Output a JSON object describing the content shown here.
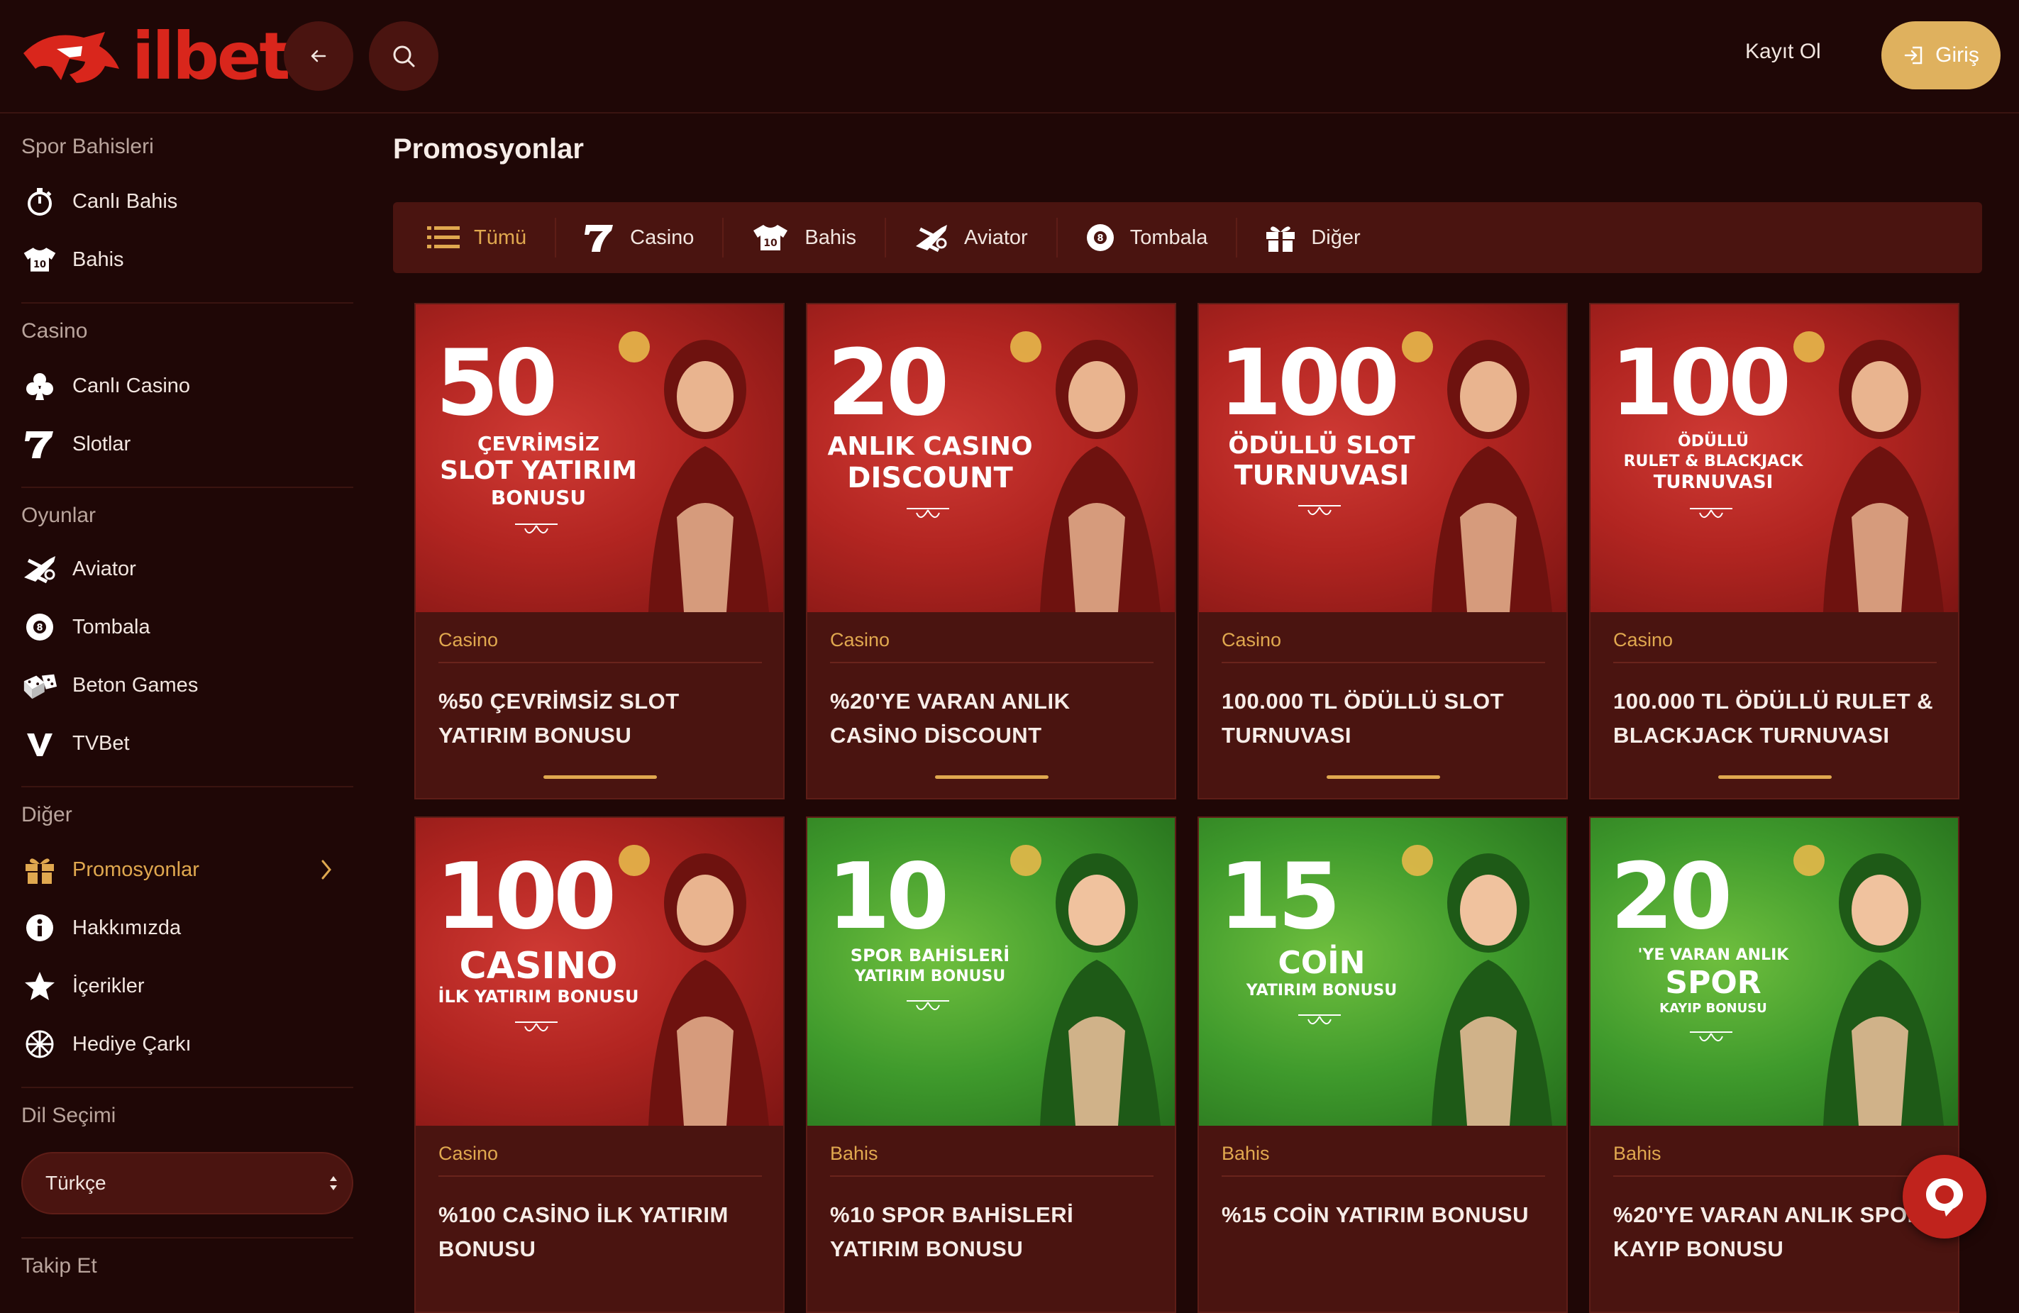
{
  "header": {
    "logo_text": "ilbet",
    "back_icon": "arrow-left-icon",
    "search_icon": "search-icon",
    "register_label": "Kayıt Ol",
    "login_label": "Giriş"
  },
  "sidebar": {
    "sections": [
      {
        "title": "Spor Bahisleri",
        "items": [
          {
            "label": "Canlı Bahis",
            "icon": "stopwatch-icon"
          },
          {
            "label": "Bahis",
            "icon": "jersey-icon"
          }
        ]
      },
      {
        "title": "Casino",
        "items": [
          {
            "label": "Canlı Casino",
            "icon": "club-icon"
          },
          {
            "label": "Slotlar",
            "icon": "seven-icon"
          }
        ]
      },
      {
        "title": "Oyunlar",
        "items": [
          {
            "label": "Aviator",
            "icon": "plane-icon"
          },
          {
            "label": "Tombala",
            "icon": "ball-icon"
          },
          {
            "label": "Beton Games",
            "icon": "dice-icon"
          },
          {
            "label": "TVBet",
            "icon": "tvbet-icon"
          }
        ]
      },
      {
        "title": "Diğer",
        "items": [
          {
            "label": "Promosyonlar",
            "icon": "gift-icon",
            "active": true
          },
          {
            "label": "Hakkımızda",
            "icon": "info-icon"
          },
          {
            "label": "İçerikler",
            "icon": "star-icon"
          },
          {
            "label": "Hediye Çarkı",
            "icon": "wheel-icon"
          }
        ]
      },
      {
        "title": "Dil Seçimi",
        "items": []
      },
      {
        "title": "Takip Et",
        "items": []
      }
    ],
    "language_value": "Türkçe"
  },
  "main": {
    "title": "Promosyonlar",
    "tabs": [
      {
        "label": "Tümü",
        "icon": "list-icon",
        "active": true
      },
      {
        "label": "Casino",
        "icon": "seven-icon"
      },
      {
        "label": "Bahis",
        "icon": "jersey-icon"
      },
      {
        "label": "Aviator",
        "icon": "plane-icon"
      },
      {
        "label": "Tombala",
        "icon": "ball-icon"
      },
      {
        "label": "Diğer",
        "icon": "gift-icon"
      }
    ],
    "cards": [
      {
        "category": "Casino",
        "title": "%50 ÇEVRİMSİZ SLOT\nYATIRIM BONUSU",
        "banner_big": "50",
        "banner_lines": [
          "ÇEVRİMSİZ",
          "SLOT YATIRIM",
          "BONUSU"
        ],
        "theme": "red"
      },
      {
        "category": "Casino",
        "title": "%20'YE VARAN ANLIK\nCASİNO DİSCOUNT",
        "banner_big": "20",
        "banner_lines": [
          "ANLIK CASINO",
          "DISCOUNT"
        ],
        "theme": "red"
      },
      {
        "category": "Casino",
        "title": "100.000 TL ÖDÜLLÜ SLOT\nTURNUVASI",
        "banner_big": "100",
        "banner_lines": [
          "ÖDÜLLÜ SLOT",
          "TURNUVASI"
        ],
        "theme": "red"
      },
      {
        "category": "Casino",
        "title": "100.000 TL ÖDÜLLÜ RULET &\nBLACKJACK TURNUVASI",
        "banner_big": "100",
        "banner_lines": [
          "ÖDÜLLÜ",
          "RULET & BLACKJACK",
          "TURNUVASI"
        ],
        "theme": "red"
      },
      {
        "category": "Casino",
        "title": "%100 CASİNO İLK YATIRIM\nBONUSU",
        "banner_big": "100",
        "banner_lines": [
          "CASINO",
          "İLK YATIRIM BONUSU"
        ],
        "theme": "red"
      },
      {
        "category": "Bahis",
        "title": "%10 SPOR BAHİSLERİ\nYATIRIM BONUSU",
        "banner_big": "10",
        "banner_lines": [
          "SPOR BAHİSLERİ",
          "YATIRIM BONUSU"
        ],
        "theme": "green"
      },
      {
        "category": "Bahis",
        "title": "%15 COİN YATIRIM BONUSU",
        "banner_big": "15",
        "banner_lines": [
          "COİN",
          "YATIRIM BONUSU"
        ],
        "theme": "green"
      },
      {
        "category": "Bahis",
        "title": "%20'YE VARAN ANLIK SPOR\nKAYIP BONUSU",
        "banner_big": "20",
        "banner_lines": [
          "'YE VARAN ANLIK",
          "SPOR",
          "KAYIP BONUSU"
        ],
        "theme": "green"
      }
    ],
    "chat_icon": "chat-bubble-icon"
  },
  "colors": {
    "background": "#1f0706",
    "panel": "#4a1410",
    "accent_gold": "#e0a84f",
    "brand_red": "#d9261c",
    "promo_red": "#b22521",
    "promo_green": "#3f9a2c"
  }
}
